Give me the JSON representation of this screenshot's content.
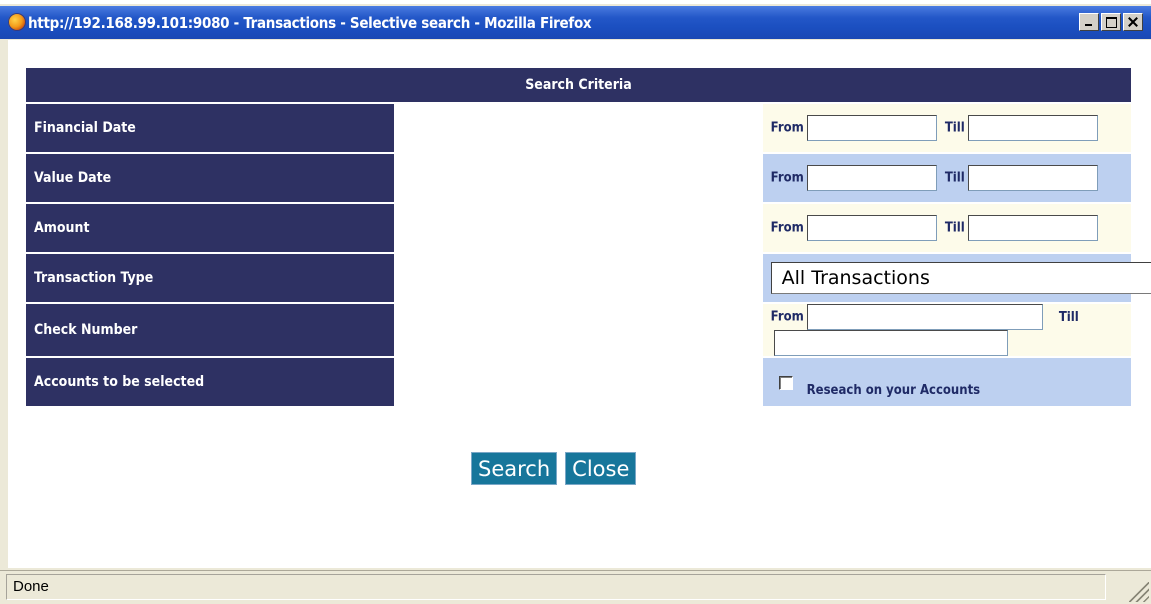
{
  "window": {
    "title": "http://192.168.99.101:9080 - Transactions - Selective search - Mozilla Firefox",
    "icon": "firefox-icon",
    "minimize_icon": "minimize-icon",
    "maximize_icon": "maximize-icon",
    "close_icon": "close-icon"
  },
  "form": {
    "header": "Search Criteria",
    "rows": [
      {
        "label": "Financial Date",
        "from_label": "From",
        "till_label": "Till",
        "from_value": "",
        "till_value": ""
      },
      {
        "label": "Value Date",
        "from_label": "From",
        "till_label": "Till",
        "from_value": "",
        "till_value": ""
      },
      {
        "label": "Amount",
        "from_label": "From",
        "till_label": "Till",
        "from_value": "",
        "till_value": ""
      },
      {
        "label": "Transaction Type",
        "selected": "All Transactions"
      },
      {
        "label": "Check Number",
        "from_label": "From",
        "till_label": "Till",
        "from_value": "",
        "till_value": ""
      },
      {
        "label": "Accounts to be selected",
        "checkbox_label": "Reseach on your Accounts",
        "checked": false
      }
    ]
  },
  "buttons": {
    "search": "Search",
    "close": "Close"
  },
  "status": {
    "text": "Done"
  },
  "colors": {
    "header_bg": "#2e3163",
    "row_light": "#fdfbea",
    "row_blue": "#bdd0f0",
    "button_bg": "#17769b",
    "titlebar": "#1b4fc0"
  }
}
